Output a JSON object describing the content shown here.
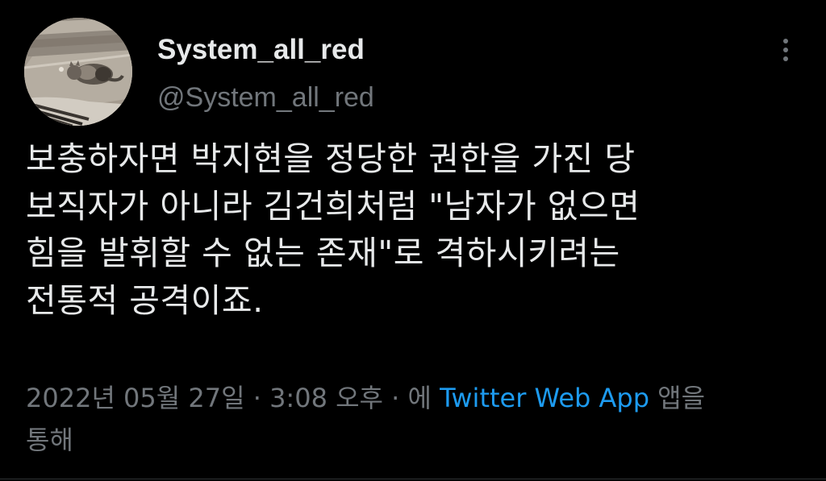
{
  "author": {
    "display_name": "System_all_red",
    "handle": "@System_all_red",
    "avatar": "cat-photo-avatar"
  },
  "actions": {
    "more_icon": "more-vertical-icon"
  },
  "tweet": {
    "text_lines": [
      "보충하자면 박지현을 정당한 권한을 가진 당",
      "보직자가 아니라 김건희처럼 \"남자가 없으면",
      "힘을 발휘할 수 없는 존재\"로 격하시키려는",
      "전통적 공격이죠."
    ]
  },
  "meta": {
    "date": "2022년 05월 27일",
    "separator": " · ",
    "time": "3:08 오후",
    "source_prefix": "에 ",
    "source": "Twitter Web App",
    "source_suffix": " 앱을",
    "continuation": "통해"
  },
  "colors": {
    "background": "#000000",
    "primary_text": "#e7e9ea",
    "secondary_text": "#71767b",
    "link": "#1d9bf0"
  }
}
